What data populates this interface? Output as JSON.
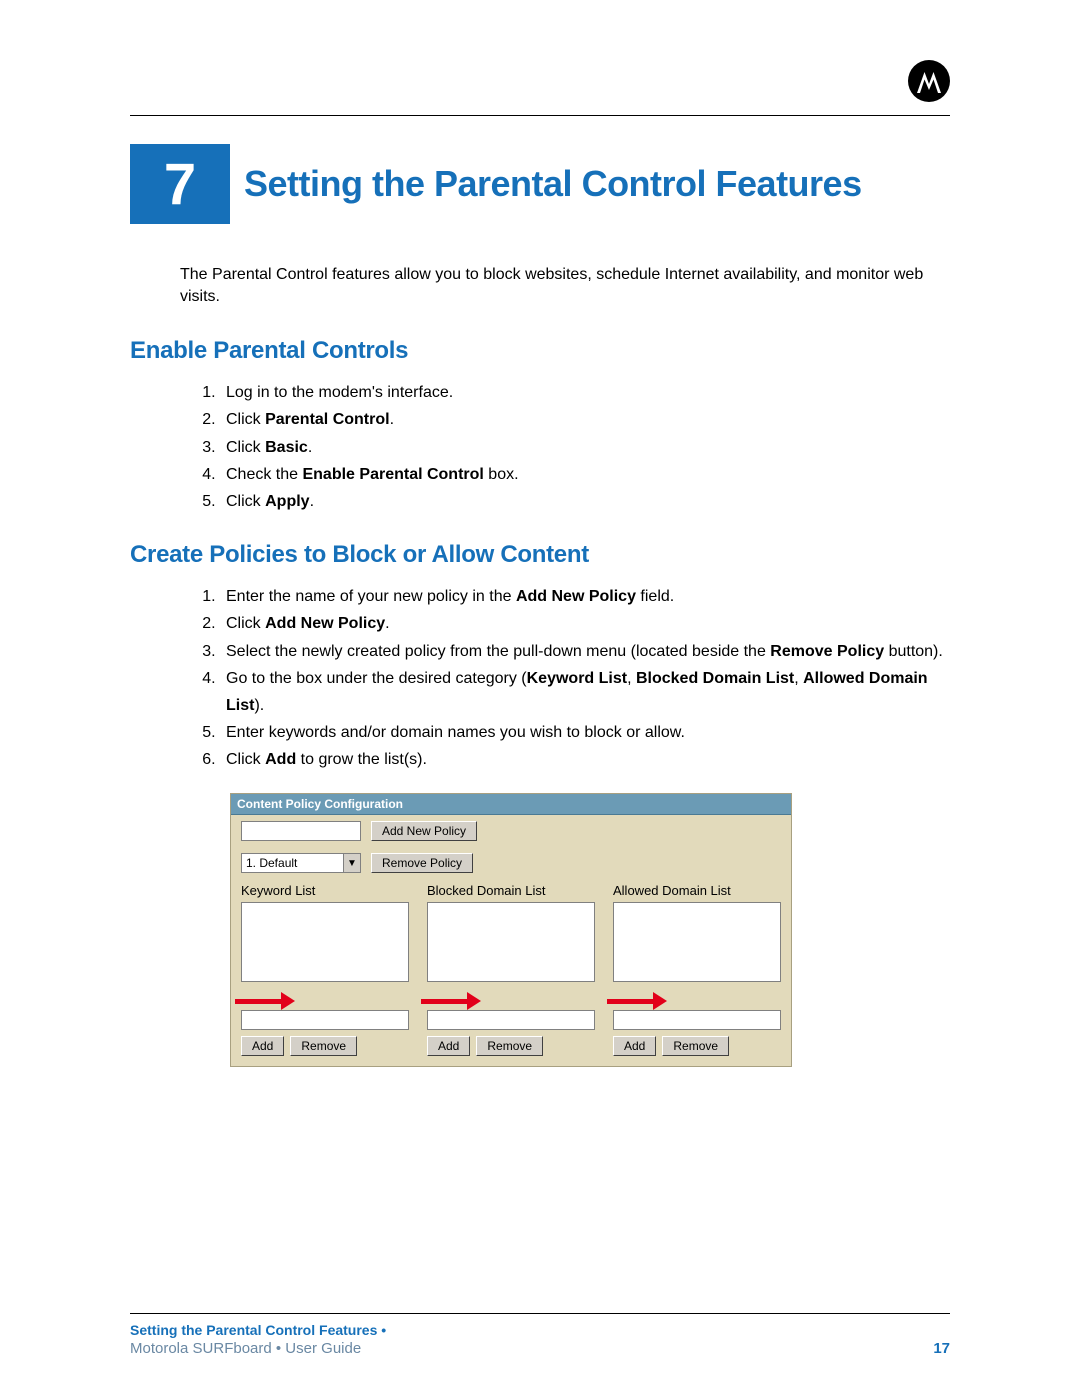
{
  "chapter": {
    "number": "7",
    "title": "Setting the Parental Control Features"
  },
  "intro": "The Parental Control features allow you to block websites, schedule Internet availability, and monitor web visits.",
  "section1": {
    "heading": "Enable Parental Controls",
    "steps": {
      "s1": "Log in to the modem's interface.",
      "s2a": "Click ",
      "s2b": "Parental Control",
      "s2c": ".",
      "s3a": "Click ",
      "s3b": "Basic",
      "s3c": ".",
      "s4a": "Check the ",
      "s4b": "Enable Parental Control",
      "s4c": " box.",
      "s5a": "Click ",
      "s5b": "Apply",
      "s5c": "."
    }
  },
  "section2": {
    "heading": "Create Policies to Block or Allow Content",
    "steps": {
      "s1a": "Enter the name of your new policy in the ",
      "s1b": "Add New Policy",
      "s1c": " field.",
      "s2a": "Click ",
      "s2b": "Add New Policy",
      "s2c": ".",
      "s3a": "Select the newly created policy from the pull-down menu (located beside the ",
      "s3b": "Remove Policy",
      "s3c": " button).",
      "s4a": "Go to the box under the desired category (",
      "s4b": "Keyword List",
      "s4c": ", ",
      "s4d": "Blocked Domain List",
      "s4e": ", ",
      "s4f": "Allowed Domain List",
      "s4g": ").",
      "s5": "Enter keywords and/or domain names you wish to block or allow.",
      "s6a": "Click ",
      "s6b": "Add",
      "s6c": " to grow the list(s)."
    }
  },
  "screenshot": {
    "title": "Content Policy Configuration",
    "add_policy_btn": "Add New Policy",
    "remove_policy_btn": "Remove Policy",
    "select_value": "1. Default",
    "col1": "Keyword List",
    "col2": "Blocked Domain List",
    "col3": "Allowed Domain List",
    "add_btn": "Add",
    "remove_btn": "Remove"
  },
  "footer": {
    "section": "Setting the Parental Control Features •",
    "guide": "Motorola SURFboard • User Guide",
    "page": "17"
  }
}
